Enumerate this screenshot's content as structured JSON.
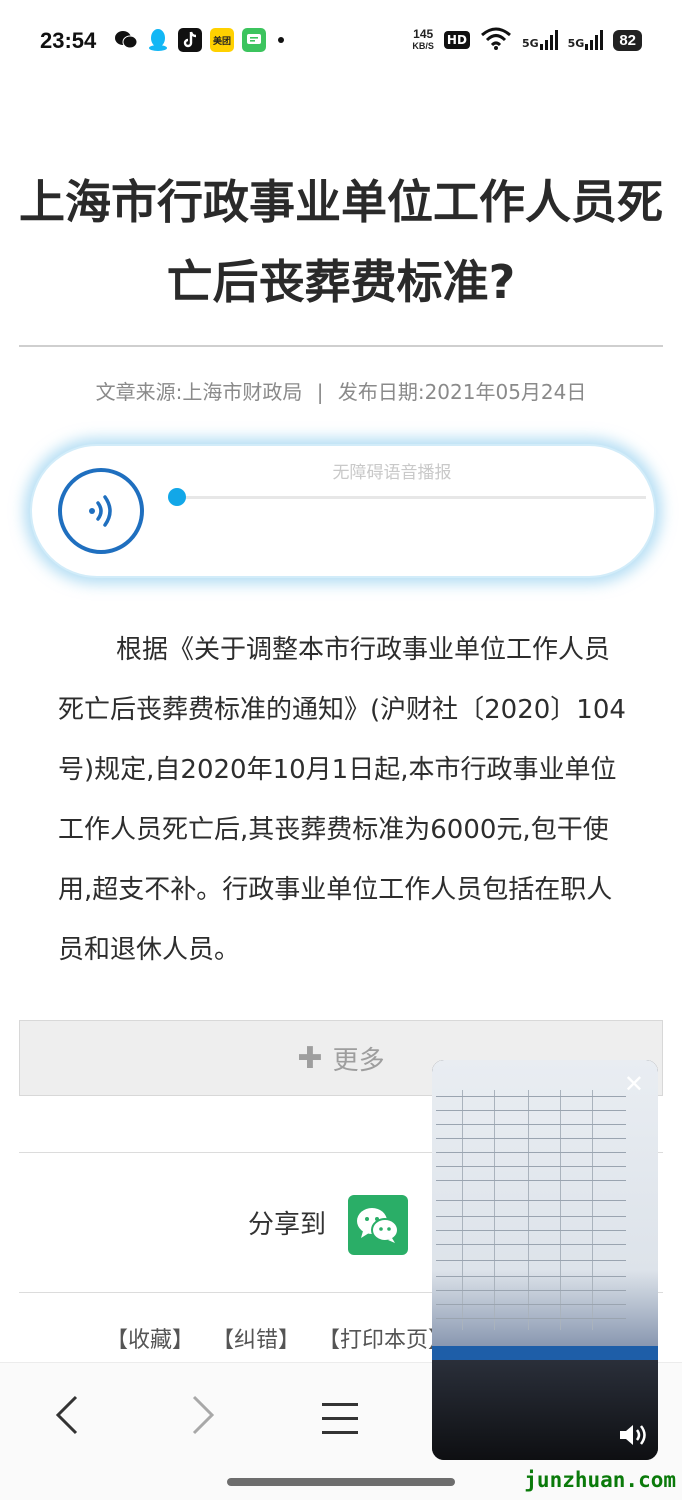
{
  "status_bar": {
    "time": "23:54",
    "speed_value": "145",
    "speed_unit": "KB/S",
    "hd_label": "HD",
    "signal_1": "5G",
    "signal_2": "5G",
    "battery": "82",
    "app_meituan": "美团"
  },
  "article": {
    "title": "上海市行政事业单位工作人员死亡后丧葬费标准?",
    "source": "文章来源:上海市财政局",
    "separator": "|",
    "date": "发布日期:2021年05月24日",
    "body": "根据《关于调整本市行政事业单位工作人员死亡后丧葬费标准的通知》(沪财社〔2020〕104号)规定,自2020年10月1日起,本市行政事业单位工作人员死亡后,其丧葬费标准为6000元,包干使用,超支不补。行政事业单位工作人员包括在职人员和退休人员。"
  },
  "audio": {
    "label": "无障碍语音播报",
    "progress": 0
  },
  "more_button": {
    "label": "更多"
  },
  "share": {
    "label": "分享到"
  },
  "footer_links": [
    "【收藏】",
    "【纠错】",
    "【打印本页】"
  ],
  "watermark": "junzhuan.com",
  "colors": {
    "accent_blue": "#1f6fbf",
    "progress_knob": "#12a7e8",
    "wechat_green": "#2aae67"
  },
  "icons": {
    "back": "chevron-left-icon",
    "forward": "chevron-right-icon",
    "menu": "hamburger-icon",
    "close": "close-icon",
    "volume": "speaker-icon"
  }
}
